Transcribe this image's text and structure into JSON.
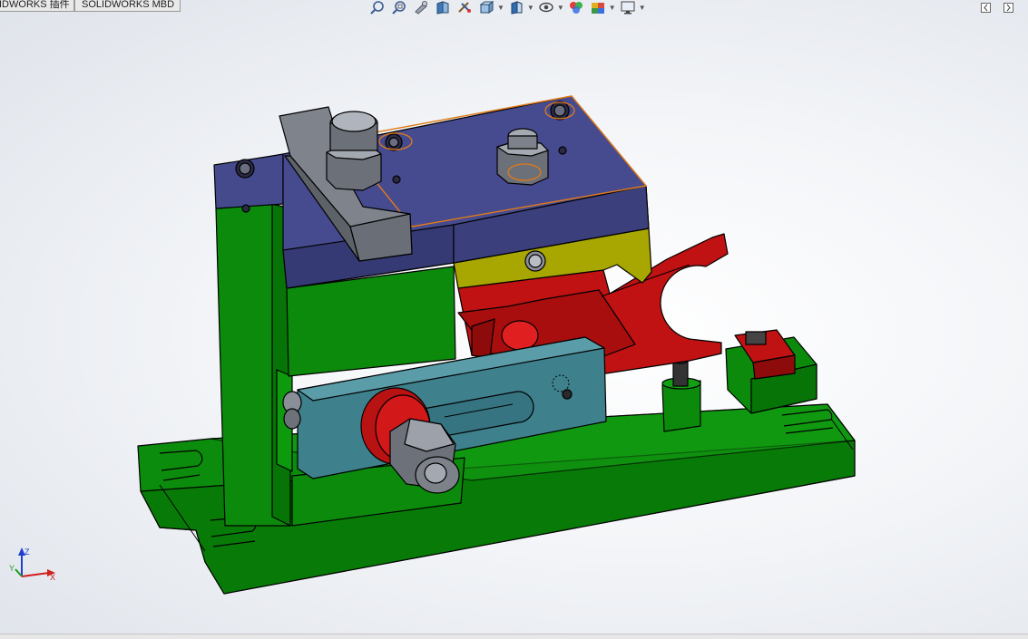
{
  "tabs": [
    {
      "label": "IDWORKS 插件"
    },
    {
      "label": "SOLIDWORKS MBD"
    }
  ],
  "heads_up_toolbar": [
    {
      "icon": "zoom-to-fit-icon"
    },
    {
      "icon": "zoom-to-area-icon"
    },
    {
      "icon": "previous-view-icon"
    },
    {
      "icon": "section-view-icon"
    },
    {
      "icon": "dynamic-annotation-icon"
    },
    {
      "icon": "view-orientation-icon"
    },
    {
      "icon": "display-style-icon"
    },
    {
      "icon": "hide-show-items-icon"
    },
    {
      "icon": "edit-appearance-icon"
    },
    {
      "icon": "apply-scene-icon"
    },
    {
      "icon": "view-settings-icon"
    }
  ],
  "window_controls": [
    {
      "icon": "restore-window-icon"
    },
    {
      "icon": "maximize-window-icon"
    }
  ],
  "triad": {
    "x_label": "X",
    "y_label": "Y",
    "z_label": "Z"
  },
  "colors": {
    "base_green": "#0a8a0a",
    "top_plate_purple": "#464a8e",
    "clamp_red": "#c21414",
    "slide_teal": "#3c7c88",
    "wedge_yellow": "#a6a400",
    "selection_orange": "#e07a18",
    "bolt_gray": "#7d8189"
  }
}
